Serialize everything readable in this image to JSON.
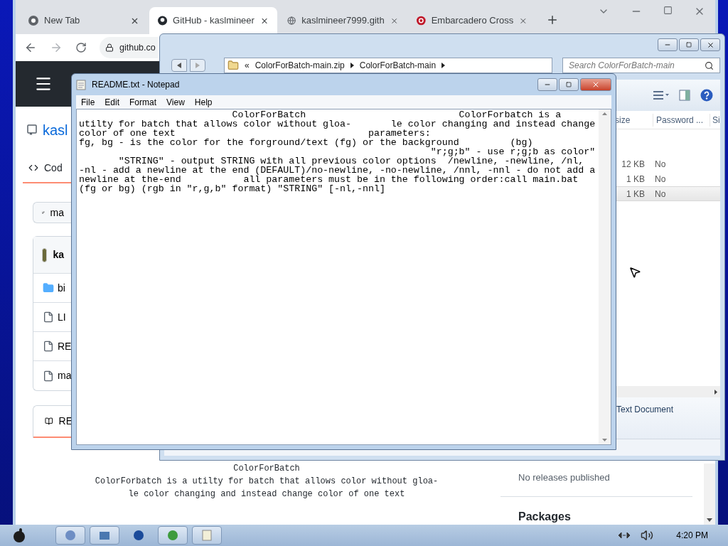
{
  "chrome": {
    "tabs": [
      {
        "label": "New Tab",
        "selected": false
      },
      {
        "label": "GitHub - kaslmineer",
        "selected": true
      },
      {
        "label": "kaslmineer7999.gith",
        "selected": false
      },
      {
        "label": "Embarcadero Cross",
        "selected": false
      }
    ],
    "address": "github.co"
  },
  "github": {
    "repo": "kasl",
    "tab": "Cod",
    "branch": "ma",
    "commit_author": "ka",
    "files": [
      {
        "name": "bi",
        "kind": "folder"
      },
      {
        "name": "LI",
        "kind": "file"
      },
      {
        "name": "RE",
        "kind": "file"
      },
      {
        "name": "ma",
        "kind": "file"
      }
    ],
    "readme_tab": "RE",
    "readme_lines": [
      "ColorForBatch",
      "ColorForbatch is a utilty for batch that allows color without gloa-",
      "le color changing and instead change color of one text"
    ],
    "releases": "No releases published",
    "packages": "Packages"
  },
  "explorer": {
    "overflow": "«",
    "breadcrumb": [
      "ColorForBatch-main.zip",
      "ColorForBatch-main"
    ],
    "search_placeholder": "Search ColorForBatch-main",
    "columns": [
      "size",
      "Password ...",
      "Si"
    ],
    "rows": [
      {
        "size": "12 KB",
        "password": "No",
        "selected": false
      },
      {
        "size": "1 KB",
        "password": "No",
        "selected": false
      },
      {
        "size": "1 KB",
        "password": "No",
        "selected": true
      }
    ],
    "details": "Text Document"
  },
  "notepad": {
    "title": "README.txt - Notepad",
    "menu": [
      "File",
      "Edit",
      "Format",
      "View",
      "Help"
    ],
    "lines": [
      "                           ColorForBatch                           ColorForbatch is a",
      "utilty for batch that allows color without gloa-       le color changing and instead change",
      "color of one text                                  parameters:",
      "fg, bg - is the color for the forground/text (fg) or the background         (bg)",
      "                                                              \"r;g;b\" - use r;g;b as color\"",
      "       \"STRING\" - output STRING with all previous color options  /newline, -newline, /nl,",
      "-nl - add a newline at the end (DEFAULT)/no-newline, -no-newline, /nnl, -nnl - do not add a",
      "newline at the-end           all parameters must be in the following order:call main.bat",
      "(fg or bg) (rgb in \"r,g,b\" format) \"STRING\" [-nl,-nnl]"
    ]
  },
  "taskbar": {
    "time": "4:20 PM"
  }
}
